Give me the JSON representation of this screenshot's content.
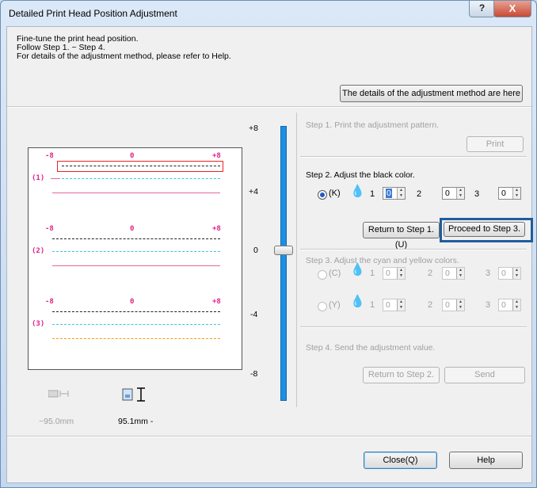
{
  "window": {
    "title": "Detailed Print Head Position Adjustment",
    "help_glyph": "?",
    "close_glyph": "X"
  },
  "intro": {
    "line1": "Fine-tune the print head position.",
    "line2": "Follow Step 1. ~ Step 4.",
    "line3": "For details of the adjustment method, please refer to Help."
  },
  "details_button": "The details of the adjustment method are here",
  "preview": {
    "groups": [
      {
        "label": "(1)",
        "left": "-8",
        "center": "0",
        "right": "+8"
      },
      {
        "label": "(2)",
        "left": "-8",
        "center": "0",
        "right": "+8"
      },
      {
        "label": "(3)",
        "left": "-8",
        "center": "0",
        "right": "+8"
      }
    ]
  },
  "slider": {
    "ticks": [
      "+8",
      "+4",
      "0",
      "-4",
      "-8"
    ],
    "value": 0
  },
  "step1": {
    "label": "Step 1. Print the adjustment pattern.",
    "print_button": "Print"
  },
  "step2": {
    "label": "Step 2. Adjust the black color.",
    "radio_label": "(K)",
    "fields": [
      {
        "index": "1",
        "value": "0"
      },
      {
        "index": "2",
        "value": "0"
      },
      {
        "index": "3",
        "value": "0"
      }
    ],
    "return_button": "Return to Step 1.(U)",
    "proceed_button": "Proceed to Step 3."
  },
  "step3": {
    "label": "Step 3. Adjust the cyan and yellow colors.",
    "cyan": {
      "radio_label": "(C)",
      "fields": [
        {
          "index": "1",
          "value": "0"
        },
        {
          "index": "2",
          "value": "0"
        },
        {
          "index": "3",
          "value": "0"
        }
      ]
    },
    "yellow": {
      "radio_label": "(Y)",
      "fields": [
        {
          "index": "1",
          "value": "0"
        },
        {
          "index": "2",
          "value": "0"
        },
        {
          "index": "3",
          "value": "0"
        }
      ]
    }
  },
  "step4": {
    "label": "Step 4. Send the adjustment value.",
    "return_button": "Return to Step 2.",
    "send_button": "Send"
  },
  "measurements": {
    "width": "~95.0mm",
    "height": "95.1mm -"
  },
  "footer": {
    "close_button": "Close(Q)",
    "help_button": "Help"
  },
  "colors": {
    "black": "#222222",
    "cyan": "#39c5e6",
    "yellow": "#f0a015",
    "magenta": "#e0208a",
    "accent": "#1f5c9e"
  }
}
